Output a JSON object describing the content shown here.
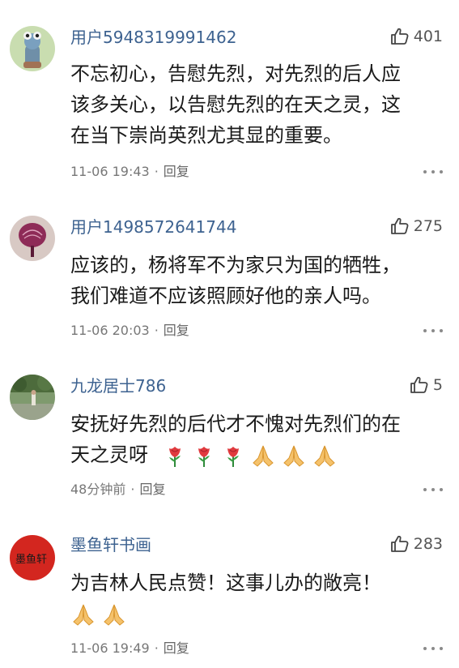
{
  "comments": [
    {
      "username": "用户5948319991462",
      "likes": "401",
      "lines": [
        "不忘初心，告慰先烈，对先烈的后人应",
        "该多关心，以告慰先烈的在天之灵，这",
        "在当下崇尚英烈尤其显的重要。"
      ],
      "time": "11-06 19:43",
      "dot": "·",
      "reply": "回复"
    },
    {
      "username": "用户1498572641744",
      "likes": "275",
      "lines": [
        "应该的，杨将军不为家只为国的牺牲，",
        "我们难道不应该照顾好他的亲人吗。"
      ],
      "time": "11-06 20:03",
      "dot": "·",
      "reply": "回复"
    },
    {
      "username": "九龙居士786",
      "likes": "5",
      "lines": [
        "安抚好先烈的后代才不愧对先烈们的在",
        "天之灵呀"
      ],
      "emojis": [
        "rose-emoji",
        "rose-emoji",
        "rose-emoji",
        "pray-emoji",
        "pray-emoji",
        "pray-emoji"
      ],
      "time": "48分钟前",
      "dot": "·",
      "reply": "回复"
    },
    {
      "username": "墨鱼轩书画",
      "likes": "283",
      "lines": [
        "为吉林人民点赞！这事儿办的敞亮！"
      ],
      "emojis": [
        "pray-emoji",
        "pray-emoji"
      ],
      "time": "11-06 19:49",
      "dot": "·",
      "reply": "回复"
    }
  ],
  "icons": {
    "like": "thumbs-up-icon",
    "more": "more-dots-icon"
  },
  "colors": {
    "username": "#3d6290",
    "text": "#1a1a1a",
    "meta": "#777777"
  }
}
